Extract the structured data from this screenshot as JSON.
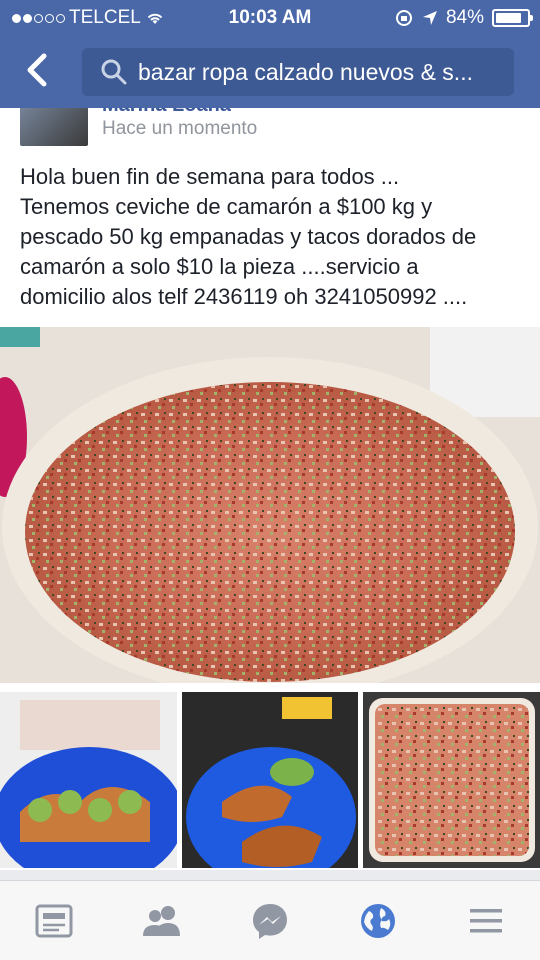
{
  "status_bar": {
    "carrier": "TELCEL",
    "time": "10:03 AM",
    "battery": "84%",
    "battery_level": 0.84
  },
  "header": {
    "search_query": "bazar ropa calzado nuevos & s..."
  },
  "post": {
    "author": "Marina Loana",
    "timestamp": "Hace un momento",
    "text": [
      "Hola buen fin de semana para todos ...",
      "Tenemos ceviche de camarón a $100 kg y",
      "pescado 50 kg empanadas y tacos dorados de",
      "camarón a solo $10 la pieza ....servicio a",
      "domicilio alos telf 2436119 oh 3241050992 ...."
    ]
  },
  "bottom_nav": {
    "items": [
      "news-feed",
      "friends",
      "messenger",
      "notifications",
      "more"
    ],
    "active": "notifications"
  },
  "colors": {
    "brand": "#4a68a8",
    "active_icon": "#4a7bd0",
    "inactive_icon": "#9197a3"
  }
}
